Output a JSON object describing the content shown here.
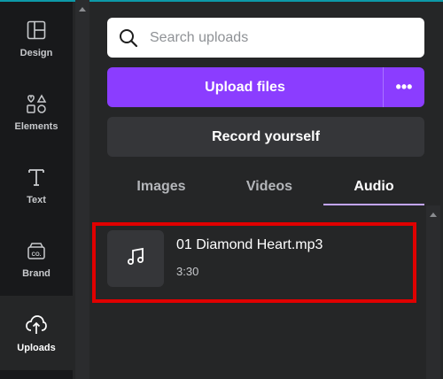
{
  "rail": {
    "items": [
      {
        "label": "Design",
        "icon": "design-icon"
      },
      {
        "label": "Elements",
        "icon": "elements-icon"
      },
      {
        "label": "Text",
        "icon": "text-icon"
      },
      {
        "label": "Brand",
        "icon": "brand-icon"
      },
      {
        "label": "Uploads",
        "icon": "uploads-icon"
      }
    ],
    "active": "Uploads"
  },
  "search": {
    "placeholder": "Search uploads",
    "value": ""
  },
  "actions": {
    "upload_label": "Upload files",
    "more_label": "•••",
    "record_label": "Record yourself"
  },
  "tabs": [
    {
      "label": "Images"
    },
    {
      "label": "Videos"
    },
    {
      "label": "Audio"
    }
  ],
  "active_tab": "Audio",
  "audio_items": [
    {
      "title": "01 Diamond Heart.mp3",
      "duration": "3:30",
      "icon": "music-note-icon"
    }
  ],
  "colors": {
    "accent": "#8b3dff",
    "tab_underline": "#c3a5ff",
    "highlight": "#e00000",
    "panel_bg": "#252627",
    "rail_bg": "#18191b"
  }
}
